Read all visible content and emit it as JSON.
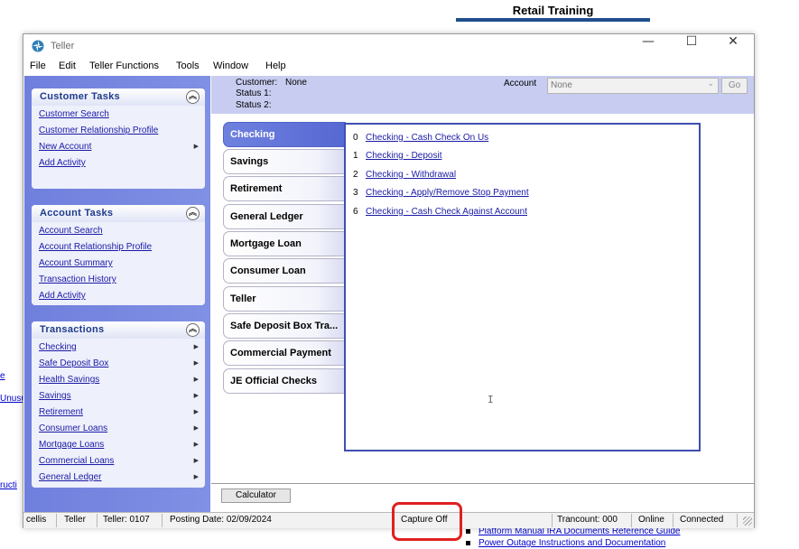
{
  "background": {
    "heading": "Retail Training",
    "fragments": [
      "e",
      "Unusu",
      "ructi"
    ],
    "links": [
      "Platform Manual IRA Documents Reference Guide",
      "Power Outage Instructions and Documentation"
    ]
  },
  "window": {
    "title": "Teller",
    "app_icon": "teller-logo-icon",
    "controls": {
      "minimize": "—",
      "maximize": "☐",
      "close": "✕"
    }
  },
  "menu": [
    "File",
    "Edit",
    "Teller Functions",
    "Tools",
    "Window",
    "Help"
  ],
  "task_panes": [
    {
      "title": "Customer Tasks",
      "items": [
        {
          "label": "Customer Search",
          "submenu": false
        },
        {
          "label": "Customer Relationship Profile",
          "submenu": false
        },
        {
          "label": "New Account",
          "submenu": true
        },
        {
          "label": "Add Activity",
          "submenu": false
        }
      ]
    },
    {
      "title": "Account Tasks",
      "items": [
        {
          "label": "Account Search",
          "submenu": false
        },
        {
          "label": "Account Relationship Profile",
          "submenu": false
        },
        {
          "label": "Account Summary",
          "submenu": false
        },
        {
          "label": "Transaction History",
          "submenu": false
        },
        {
          "label": "Add Activity",
          "submenu": false
        }
      ]
    },
    {
      "title": "Transactions",
      "items": [
        {
          "label": "Checking",
          "submenu": true
        },
        {
          "label": "Safe Deposit Box",
          "submenu": true
        },
        {
          "label": "Health Savings",
          "submenu": true
        },
        {
          "label": "Savings",
          "submenu": true
        },
        {
          "label": "Retirement",
          "submenu": true
        },
        {
          "label": "Consumer Loans",
          "submenu": true
        },
        {
          "label": "Mortgage Loans",
          "submenu": true
        },
        {
          "label": "Commercial Loans",
          "submenu": true
        },
        {
          "label": "General Ledger",
          "submenu": true
        }
      ]
    }
  ],
  "customer": {
    "customer_label": "Customer:",
    "customer_value": "None",
    "status1_label": "Status 1:",
    "status2_label": "Status 2:",
    "account_label": "Account",
    "account_value": "None",
    "go_label": "Go"
  },
  "tabs": [
    "Checking",
    "Savings",
    "Retirement",
    "General Ledger",
    "Mortgage Loan",
    "Consumer Loan",
    "Teller",
    "Safe Deposit Box Tra...",
    "Commercial Payment",
    "JE Official Checks"
  ],
  "active_tab": 0,
  "transactions": [
    {
      "code": "0",
      "label": "Checking - Cash Check On Us"
    },
    {
      "code": "1",
      "label": "Checking - Deposit"
    },
    {
      "code": "2",
      "label": "Checking - Withdrawal"
    },
    {
      "code": "3",
      "label": "Checking - Apply/Remove Stop Payment"
    },
    {
      "code": "6",
      "label": "Checking - Cash Check Against Account"
    }
  ],
  "calculator_label": "Calculator",
  "status": {
    "user": "cellis",
    "role": "Teller",
    "teller": "Teller: 0107",
    "posting_date": "Posting Date: 02/09/2024",
    "capture": "Capture Off",
    "trancount": "Trancount: 000",
    "online": "Online",
    "connection": "Connected"
  },
  "colors": {
    "taskpane": "#7585e0",
    "active_tab": "#5d6fd6",
    "link": "#1a1aa6",
    "highlight_ring": "#e02020"
  }
}
